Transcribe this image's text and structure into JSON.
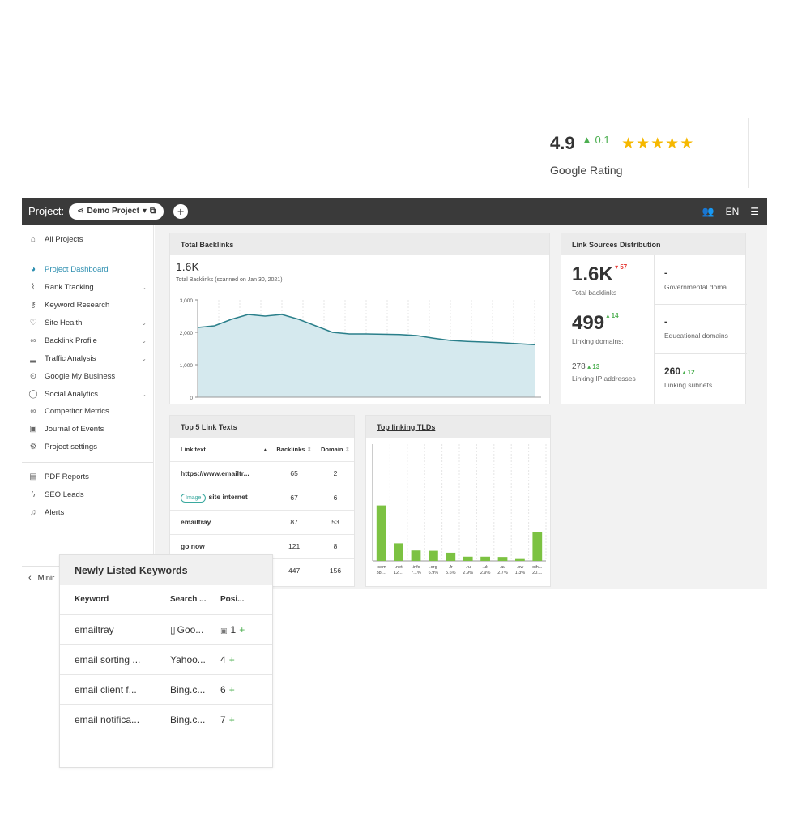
{
  "rating": {
    "score": "4.9",
    "delta": "0.1",
    "stars": "★★★★★",
    "label": "Google Rating"
  },
  "topbar": {
    "project_label": "Project:",
    "project_name": "Demo Project",
    "lang": "EN"
  },
  "sidebar": {
    "all_projects": "All Projects",
    "items": [
      {
        "label": "Project Dashboard",
        "icon": "dashboard-icon",
        "chevron": false,
        "active": true
      },
      {
        "label": "Rank Tracking",
        "icon": "chart-icon",
        "chevron": true
      },
      {
        "label": "Keyword Research",
        "icon": "key-icon",
        "chevron": false
      },
      {
        "label": "Site Health",
        "icon": "heart-icon",
        "chevron": true
      },
      {
        "label": "Backlink Profile",
        "icon": "link-icon",
        "chevron": true
      },
      {
        "label": "Traffic Analysis",
        "icon": "bars-icon",
        "chevron": true
      },
      {
        "label": "Google My Business",
        "icon": "pin-icon",
        "chevron": false
      },
      {
        "label": "Social Analytics",
        "icon": "chat-icon",
        "chevron": true
      },
      {
        "label": "Competitor Metrics",
        "icon": "binoculars-icon",
        "chevron": false
      },
      {
        "label": "Journal of Events",
        "icon": "calendar-icon",
        "chevron": false
      },
      {
        "label": "Project settings",
        "icon": "gear-icon",
        "chevron": false
      }
    ],
    "bottom_items": [
      {
        "label": "PDF Reports",
        "icon": "pdf-icon"
      },
      {
        "label": "SEO Leads",
        "icon": "bolt-icon"
      },
      {
        "label": "Alerts",
        "icon": "bell-icon"
      }
    ],
    "minimize": "Minir"
  },
  "total_backlinks": {
    "title": "Total Backlinks",
    "value": "1.6K",
    "subtitle": "Total Backlinks (scanned on Jan 30, 2021)"
  },
  "chart_data": [
    {
      "type": "area",
      "title": "Total Backlinks",
      "x": [
        0,
        1,
        2,
        3,
        4,
        5,
        6,
        7,
        8,
        9,
        10,
        11,
        12,
        13,
        14,
        15,
        16,
        17,
        18,
        19,
        20
      ],
      "values": [
        2150,
        2200,
        2400,
        2550,
        2500,
        2550,
        2400,
        2200,
        2000,
        1950,
        1950,
        1940,
        1930,
        1900,
        1820,
        1750,
        1720,
        1700,
        1680,
        1650,
        1620
      ],
      "yticks": [
        "0",
        "1,000",
        "2,000",
        "3,000"
      ],
      "ylim": [
        0,
        3000
      ],
      "color": "#2a7f8a"
    },
    {
      "type": "bar",
      "title": "Top linking TLDs",
      "categories": [
        ".com",
        ".net",
        ".info",
        ".org",
        ".fr",
        ".ru",
        ".uk",
        ".au",
        ".pw",
        "oth..."
      ],
      "labels": [
        "38....",
        "12....",
        "7.1%",
        "6.9%",
        "5.6%",
        "2.9%",
        "2.9%",
        "2.7%",
        "1.3%",
        "20...."
      ],
      "values": [
        38,
        12,
        7.1,
        6.9,
        5.6,
        2.9,
        2.9,
        2.7,
        1.3,
        20
      ],
      "color": "#7cc242"
    }
  ],
  "link_sources": {
    "title": "Link Sources Distribution",
    "total_backlinks": {
      "value": "1.6K",
      "delta": "57",
      "label": "Total backlinks"
    },
    "linking_domains": {
      "value": "499",
      "delta": "14",
      "label": "Linking domains:"
    },
    "ip_addresses": {
      "value": "278",
      "delta": "13",
      "label": "Linking IP addresses"
    },
    "gov": {
      "value": "-",
      "label": "Governmental doma..."
    },
    "edu": {
      "value": "-",
      "label": "Educational domains"
    },
    "subnets": {
      "value": "260",
      "delta": "12",
      "label": "Linking subnets"
    }
  },
  "top5": {
    "title": "Top 5 Link Texts",
    "headers": [
      "Link text",
      "Backlinks",
      "Domain"
    ],
    "rows": [
      {
        "text": "https://www.emailtr...",
        "backlinks": "65",
        "domain": "2",
        "image": false
      },
      {
        "text": "site internet",
        "backlinks": "67",
        "domain": "6",
        "image": true,
        "badge": "Image"
      },
      {
        "text": "emailtray",
        "backlinks": "87",
        "domain": "53",
        "image": false
      },
      {
        "text": "go now",
        "backlinks": "121",
        "domain": "8",
        "image": false
      },
      {
        "text": "",
        "backlinks": "447",
        "domain": "156",
        "image": false
      }
    ]
  },
  "tld": {
    "title": "Top linking TLDs"
  },
  "newly_keywords": {
    "title": "Newly Listed Keywords",
    "headers": [
      "Keyword",
      "Search ...",
      "Posi..."
    ],
    "rows": [
      {
        "keyword": "emailtray",
        "engine": "Goo...",
        "position": "1",
        "mobile": true
      },
      {
        "keyword": "email sorting ...",
        "engine": "Yahoo...",
        "position": "4",
        "mobile": false
      },
      {
        "keyword": "email client f...",
        "engine": "Bing.c...",
        "position": "6",
        "mobile": false
      },
      {
        "keyword": "email notifica...",
        "engine": "Bing.c...",
        "position": "7",
        "mobile": false
      }
    ]
  }
}
